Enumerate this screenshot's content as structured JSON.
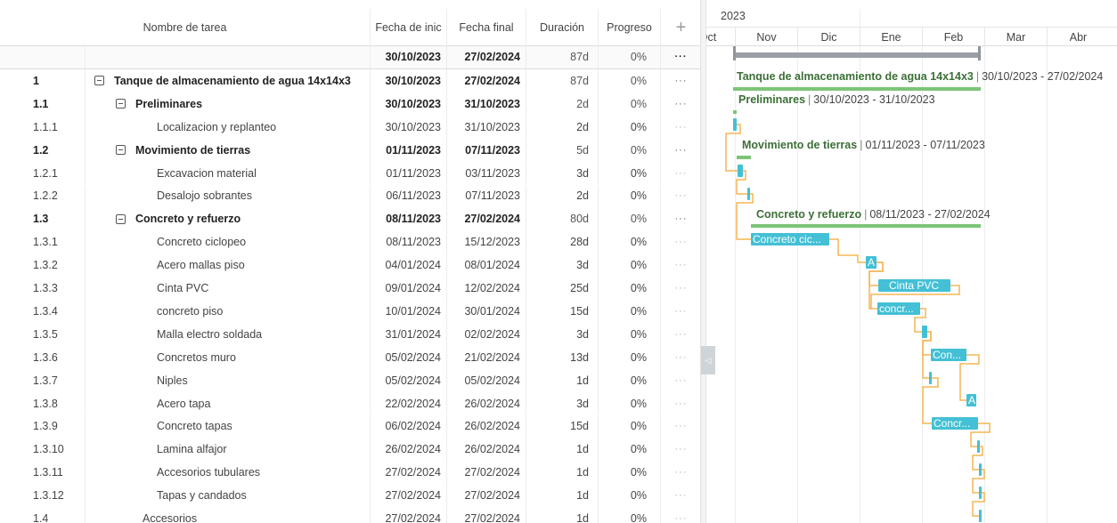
{
  "columns": {
    "name": "Nombre de tarea",
    "start": "Fecha de inic",
    "end": "Fecha final",
    "duration": "Duración",
    "progress": "Progreso",
    "add_icon": "plus-icon"
  },
  "project_summary": {
    "start": "30/10/2023",
    "end": "27/02/2024",
    "duration": "87d",
    "progress": "0%",
    "more": "···"
  },
  "rows": [
    {
      "wbs": "1",
      "name": "Tanque de almacenamiento de agua 14x14x3",
      "start": "30/10/2023",
      "end": "27/02/2024",
      "duration": "87d",
      "progress": "0%",
      "more": "···"
    },
    {
      "wbs": "1.1",
      "name": "Preliminares",
      "start": "30/10/2023",
      "end": "31/10/2023",
      "duration": "2d",
      "progress": "0%",
      "more": "···"
    },
    {
      "wbs": "1.1.1",
      "name": "Localizacion y replanteo",
      "start": "30/10/2023",
      "end": "31/10/2023",
      "duration": "2d",
      "progress": "0%",
      "more": "···"
    },
    {
      "wbs": "1.2",
      "name": "Movimiento de tierras",
      "start": "01/11/2023",
      "end": "07/11/2023",
      "duration": "5d",
      "progress": "0%",
      "more": "···"
    },
    {
      "wbs": "1.2.1",
      "name": "Excavacion material",
      "start": "01/11/2023",
      "end": "03/11/2023",
      "duration": "3d",
      "progress": "0%",
      "more": "···"
    },
    {
      "wbs": "1.2.2",
      "name": "Desalojo sobrantes",
      "start": "06/11/2023",
      "end": "07/11/2023",
      "duration": "2d",
      "progress": "0%",
      "more": "···"
    },
    {
      "wbs": "1.3",
      "name": "Concreto y refuerzo",
      "start": "08/11/2023",
      "end": "27/02/2024",
      "duration": "80d",
      "progress": "0%",
      "more": "···"
    },
    {
      "wbs": "1.3.1",
      "name": "Concreto ciclopeo",
      "start": "08/11/2023",
      "end": "15/12/2023",
      "duration": "28d",
      "progress": "0%",
      "more": "···"
    },
    {
      "wbs": "1.3.2",
      "name": "Acero mallas piso",
      "start": "04/01/2024",
      "end": "08/01/2024",
      "duration": "3d",
      "progress": "0%",
      "more": "···"
    },
    {
      "wbs": "1.3.3",
      "name": "Cinta PVC",
      "start": "09/01/2024",
      "end": "12/02/2024",
      "duration": "25d",
      "progress": "0%",
      "more": "···"
    },
    {
      "wbs": "1.3.4",
      "name": "concreto piso",
      "start": "10/01/2024",
      "end": "30/01/2024",
      "duration": "15d",
      "progress": "0%",
      "more": "···"
    },
    {
      "wbs": "1.3.5",
      "name": "Malla electro soldada",
      "start": "31/01/2024",
      "end": "02/02/2024",
      "duration": "3d",
      "progress": "0%",
      "more": "···"
    },
    {
      "wbs": "1.3.6",
      "name": "Concretos muro",
      "start": "05/02/2024",
      "end": "21/02/2024",
      "duration": "13d",
      "progress": "0%",
      "more": "···"
    },
    {
      "wbs": "1.3.7",
      "name": "Niples",
      "start": "05/02/2024",
      "end": "05/02/2024",
      "duration": "1d",
      "progress": "0%",
      "more": "···"
    },
    {
      "wbs": "1.3.8",
      "name": "Acero tapa",
      "start": "22/02/2024",
      "end": "26/02/2024",
      "duration": "3d",
      "progress": "0%",
      "more": "···"
    },
    {
      "wbs": "1.3.9",
      "name": "Concreto tapas",
      "start": "06/02/2024",
      "end": "26/02/2024",
      "duration": "15d",
      "progress": "0%",
      "more": "···"
    },
    {
      "wbs": "1.3.10",
      "name": "Lamina alfajor",
      "start": "26/02/2024",
      "end": "26/02/2024",
      "duration": "1d",
      "progress": "0%",
      "more": "···"
    },
    {
      "wbs": "1.3.11",
      "name": "Accesorios tubulares",
      "start": "27/02/2024",
      "end": "27/02/2024",
      "duration": "1d",
      "progress": "0%",
      "more": "···"
    },
    {
      "wbs": "1.3.12",
      "name": "Tapas y candados",
      "start": "27/02/2024",
      "end": "27/02/2024",
      "duration": "1d",
      "progress": "0%",
      "more": "···"
    },
    {
      "wbs": "1.4",
      "name": "Accesorios",
      "start": "27/02/2024",
      "end": "27/02/2024",
      "duration": "1d",
      "progress": "0%",
      "more": "···"
    }
  ],
  "gantt": {
    "year": "2023",
    "months": [
      "Oct",
      "Nov",
      "Dic",
      "Ene",
      "Feb",
      "Mar",
      "Abr"
    ],
    "bar_labels": {
      "t1_3_1": "Concreto cic...",
      "t1_3_2": "A",
      "t1_3_3": "Cinta PVC",
      "t1_3_4": "concr...",
      "t1_3_6": "Con...",
      "t1_3_8": "A",
      "t1_3_9": "Concr..."
    },
    "summary_labels": [
      {
        "name": "Tanque de almacenamiento de agua 14x14x3",
        "dates": "30/10/2023 - 27/02/2024"
      },
      {
        "name": "Preliminares",
        "dates": "30/10/2023 - 31/10/2023"
      },
      {
        "name": "Movimiento de tierras",
        "dates": "01/11/2023 - 07/11/2023"
      },
      {
        "name": "Concreto y refuerzo",
        "dates": "08/11/2023 - 27/02/2024"
      }
    ],
    "colors": {
      "task": "#43c0d5",
      "summary": "#7cc576",
      "project": "#9aa0a6",
      "dependency": "#f5b655"
    }
  }
}
